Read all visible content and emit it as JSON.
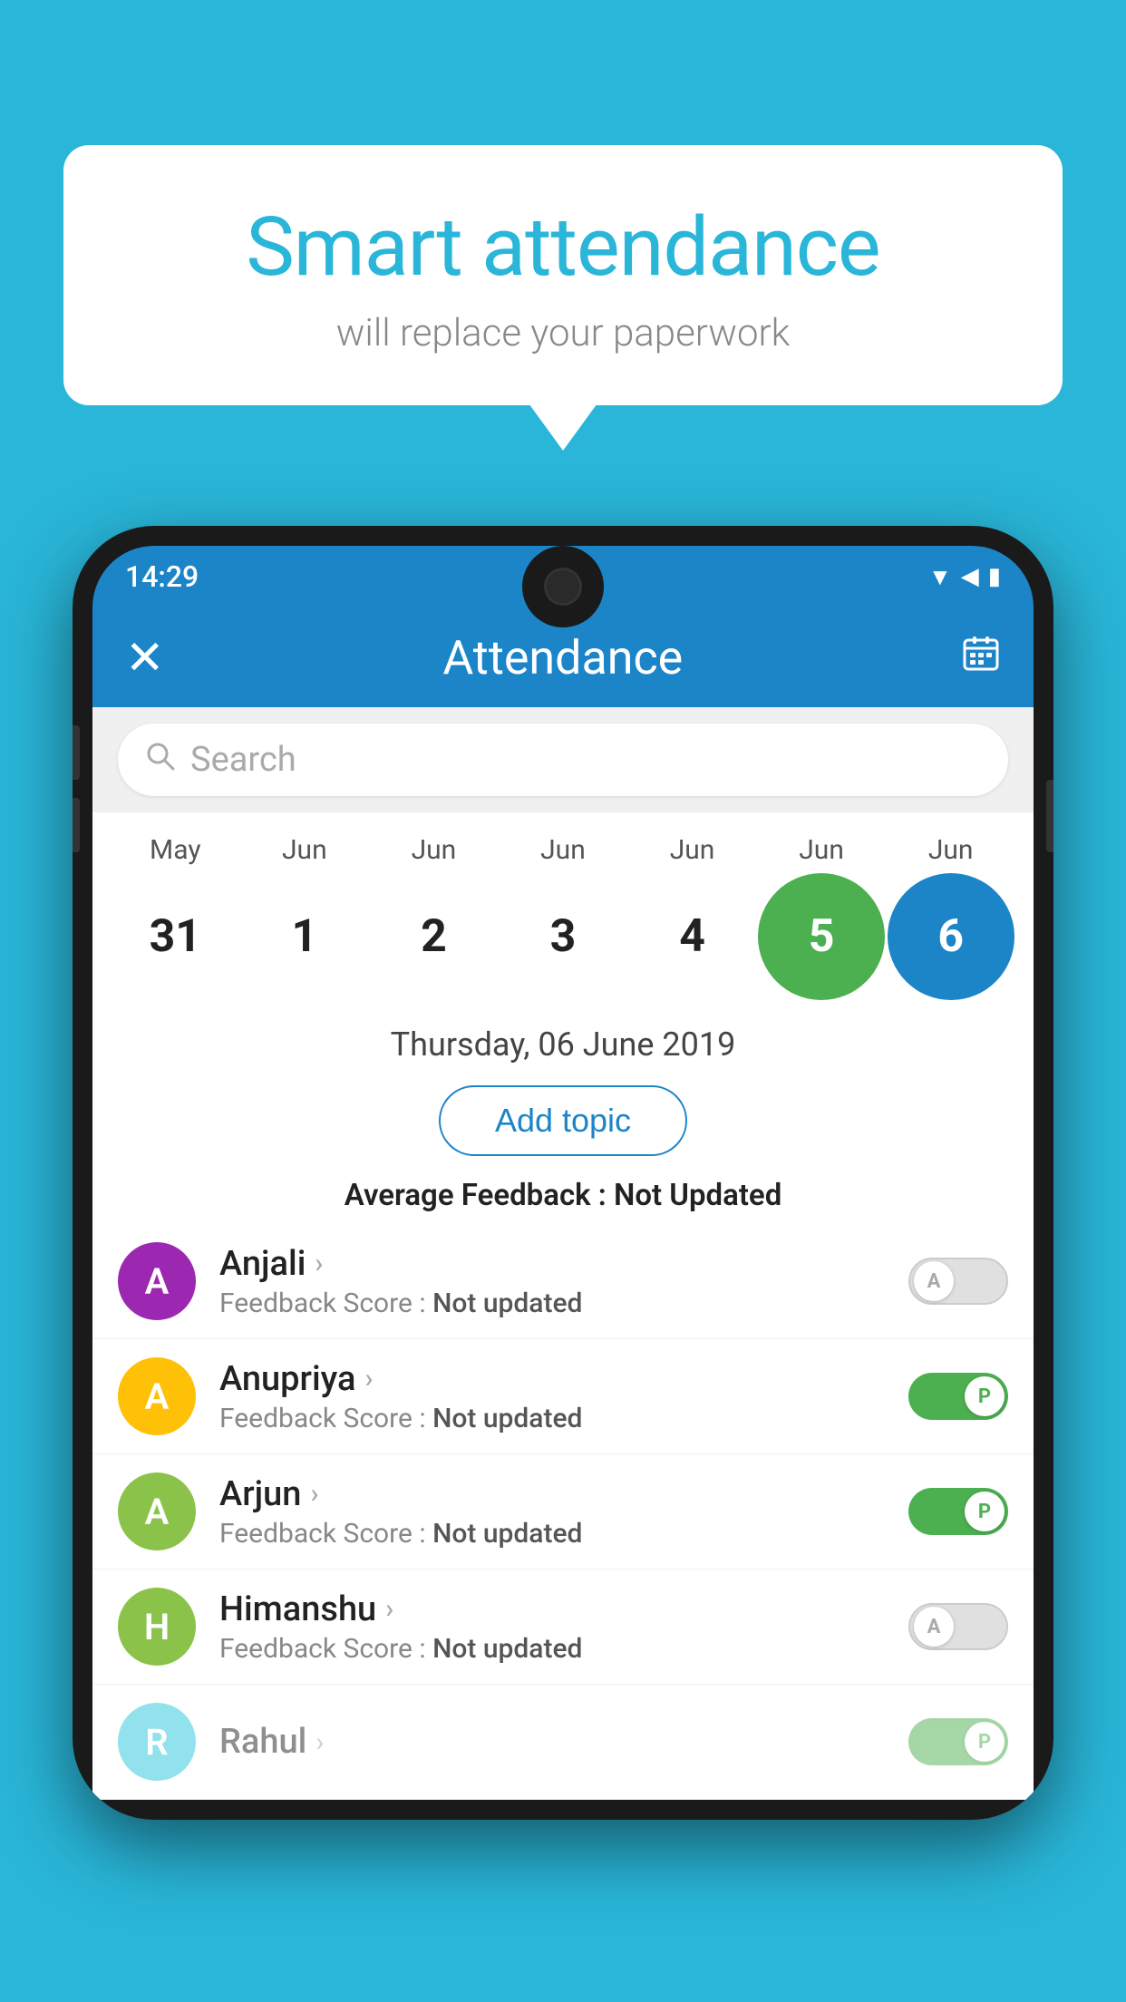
{
  "background_color": "#29B6D8",
  "bubble": {
    "title": "Smart attendance",
    "subtitle": "will replace your paperwork"
  },
  "status_bar": {
    "time": "14:29",
    "wifi": "▲",
    "signal": "▲",
    "battery": "▮"
  },
  "app_bar": {
    "title": "Attendance",
    "close_label": "✕",
    "calendar_label": "📅"
  },
  "search": {
    "placeholder": "Search"
  },
  "calendar": {
    "months": [
      "May",
      "Jun",
      "Jun",
      "Jun",
      "Jun",
      "Jun",
      "Jun"
    ],
    "dates": [
      "31",
      "1",
      "2",
      "3",
      "4",
      "5",
      "6"
    ],
    "selected_index": 5,
    "current_index": 6
  },
  "selected_date_label": "Thursday, 06 June 2019",
  "add_topic_label": "Add topic",
  "average_feedback": {
    "label": "Average Feedback : ",
    "value": "Not Updated"
  },
  "students": [
    {
      "name": "Anjali",
      "avatar_letter": "A",
      "avatar_color": "#9C27B0",
      "feedback_label": "Feedback Score : ",
      "feedback_value": "Not updated",
      "toggle_state": "off",
      "toggle_label": "A"
    },
    {
      "name": "Anupriya",
      "avatar_letter": "A",
      "avatar_color": "#FFC107",
      "feedback_label": "Feedback Score : ",
      "feedback_value": "Not updated",
      "toggle_state": "on",
      "toggle_label": "P"
    },
    {
      "name": "Arjun",
      "avatar_letter": "A",
      "avatar_color": "#8BC34A",
      "feedback_label": "Feedback Score : ",
      "feedback_value": "Not updated",
      "toggle_state": "on",
      "toggle_label": "P"
    },
    {
      "name": "Himanshu",
      "avatar_letter": "H",
      "avatar_color": "#8BC34A",
      "feedback_label": "Feedback Score : ",
      "feedback_value": "Not updated",
      "toggle_state": "off",
      "toggle_label": "A"
    }
  ]
}
